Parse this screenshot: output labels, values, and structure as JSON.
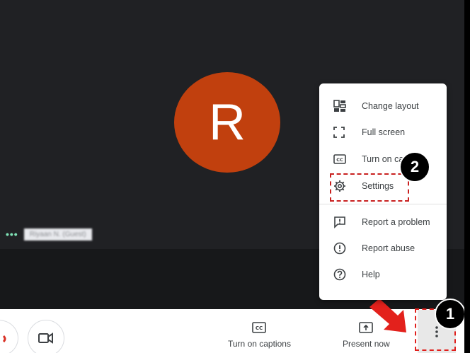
{
  "avatar": {
    "initial": "R"
  },
  "participant": {
    "name_blurred": "Riyaan N. (Guest)"
  },
  "menu": {
    "items": [
      {
        "label": "Change layout",
        "icon": "layout-icon"
      },
      {
        "label": "Full screen",
        "icon": "fullscreen-icon"
      },
      {
        "label": "Turn on ca",
        "icon": "captions-icon"
      },
      {
        "label": "Settings",
        "icon": "gear-icon"
      },
      {
        "label": "Report a problem",
        "icon": "report-problem-icon"
      },
      {
        "label": "Report abuse",
        "icon": "report-abuse-icon"
      },
      {
        "label": "Help",
        "icon": "help-icon"
      }
    ]
  },
  "bottom": {
    "captions_label": "Turn on captions",
    "present_label": "Present now"
  },
  "annotations": {
    "badge1": "1",
    "badge2": "2"
  },
  "colors": {
    "avatar": "#c1400e",
    "stage": "#202124",
    "highlight": "#e0201d"
  }
}
